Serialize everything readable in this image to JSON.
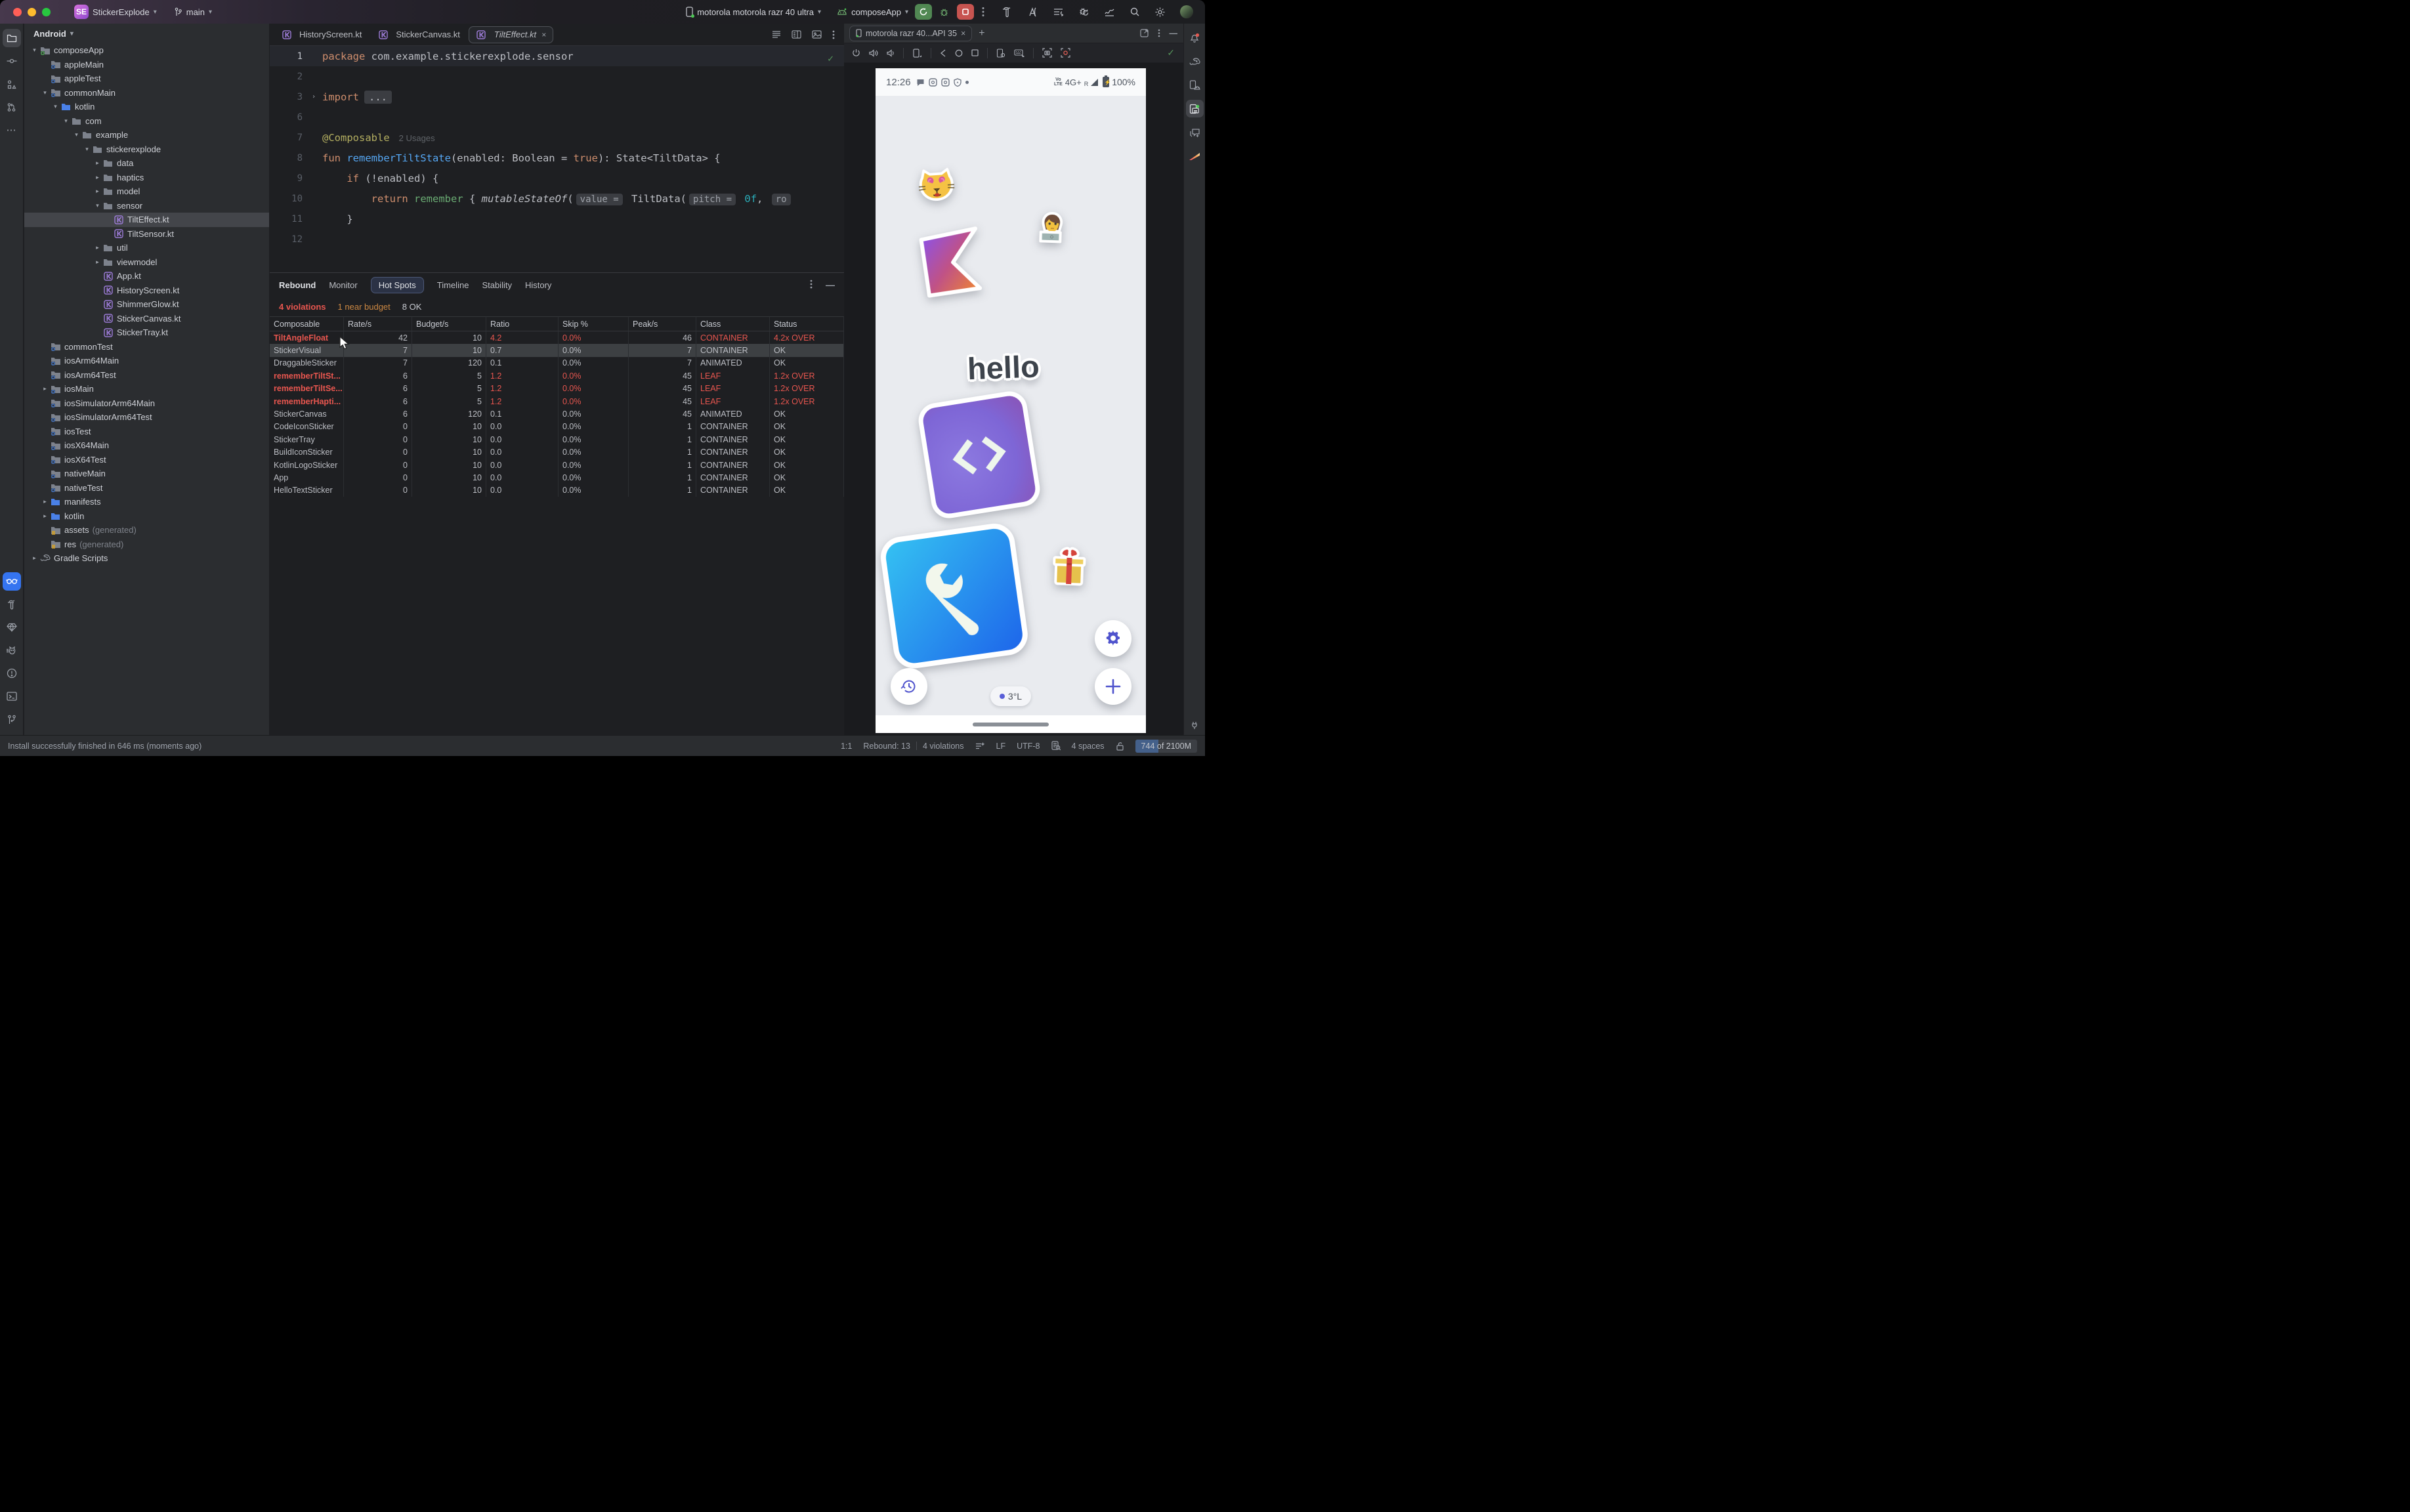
{
  "title_bar": {
    "project_abbr": "SE",
    "project_name": "StickerExplode",
    "branch": "main",
    "device_selector": "motorola motorola razr 40 ultra",
    "run_config": "composeApp"
  },
  "project_panel": {
    "header": "Android",
    "tree": [
      {
        "label": "composeApp",
        "depth": 0,
        "arrow": "v",
        "icon": "module-green"
      },
      {
        "label": "appleMain",
        "depth": 1,
        "arrow": "",
        "icon": "module-blue"
      },
      {
        "label": "appleTest",
        "depth": 1,
        "arrow": "",
        "icon": "module-blue"
      },
      {
        "label": "commonMain",
        "depth": 1,
        "arrow": "v",
        "icon": "module-blue"
      },
      {
        "label": "kotlin",
        "depth": 2,
        "arrow": "v",
        "icon": "folder-blue"
      },
      {
        "label": "com",
        "depth": 3,
        "arrow": "v",
        "icon": "folder"
      },
      {
        "label": "example",
        "depth": 4,
        "arrow": "v",
        "icon": "folder"
      },
      {
        "label": "stickerexplode",
        "depth": 5,
        "arrow": "v",
        "icon": "folder"
      },
      {
        "label": "data",
        "depth": 6,
        "arrow": ">",
        "icon": "folder"
      },
      {
        "label": "haptics",
        "depth": 6,
        "arrow": ">",
        "icon": "folder"
      },
      {
        "label": "model",
        "depth": 6,
        "arrow": ">",
        "icon": "folder"
      },
      {
        "label": "sensor",
        "depth": 6,
        "arrow": "v",
        "icon": "folder"
      },
      {
        "label": "TiltEffect.kt",
        "depth": 7,
        "arrow": "",
        "icon": "kt",
        "selected": true
      },
      {
        "label": "TiltSensor.kt",
        "depth": 7,
        "arrow": "",
        "icon": "kt"
      },
      {
        "label": "util",
        "depth": 6,
        "arrow": ">",
        "icon": "folder"
      },
      {
        "label": "viewmodel",
        "depth": 6,
        "arrow": ">",
        "icon": "folder"
      },
      {
        "label": "App.kt",
        "depth": 6,
        "arrow": "",
        "icon": "kt"
      },
      {
        "label": "HistoryScreen.kt",
        "depth": 6,
        "arrow": "",
        "icon": "kt"
      },
      {
        "label": "ShimmerGlow.kt",
        "depth": 6,
        "arrow": "",
        "icon": "kt"
      },
      {
        "label": "StickerCanvas.kt",
        "depth": 6,
        "arrow": "",
        "icon": "kt"
      },
      {
        "label": "StickerTray.kt",
        "depth": 6,
        "arrow": "",
        "icon": "kt"
      },
      {
        "label": "commonTest",
        "depth": 1,
        "arrow": "",
        "icon": "module-blue"
      },
      {
        "label": "iosArm64Main",
        "depth": 1,
        "arrow": "",
        "icon": "module-blue"
      },
      {
        "label": "iosArm64Test",
        "depth": 1,
        "arrow": "",
        "icon": "module-blue"
      },
      {
        "label": "iosMain",
        "depth": 1,
        "arrow": ">",
        "icon": "module-blue"
      },
      {
        "label": "iosSimulatorArm64Main",
        "depth": 1,
        "arrow": "",
        "icon": "module-blue"
      },
      {
        "label": "iosSimulatorArm64Test",
        "depth": 1,
        "arrow": "",
        "icon": "module-blue"
      },
      {
        "label": "iosTest",
        "depth": 1,
        "arrow": "",
        "icon": "module-blue"
      },
      {
        "label": "iosX64Main",
        "depth": 1,
        "arrow": "",
        "icon": "module-blue"
      },
      {
        "label": "iosX64Test",
        "depth": 1,
        "arrow": "",
        "icon": "module-blue"
      },
      {
        "label": "nativeMain",
        "depth": 1,
        "arrow": "",
        "icon": "module-blue"
      },
      {
        "label": "nativeTest",
        "depth": 1,
        "arrow": "",
        "icon": "module-blue"
      },
      {
        "label": "manifests",
        "depth": 1,
        "arrow": ">",
        "icon": "folder-blue"
      },
      {
        "label": "kotlin",
        "depth": 1,
        "arrow": ">",
        "icon": "folder-blue"
      },
      {
        "label": "assets",
        "depth": 1,
        "arrow": "",
        "icon": "folder-gen",
        "suffix": "(generated)"
      },
      {
        "label": "res",
        "depth": 1,
        "arrow": "",
        "icon": "folder-gen",
        "suffix": "(generated)"
      },
      {
        "label": "Gradle Scripts",
        "depth": 0,
        "arrow": ">",
        "icon": "gradle"
      }
    ]
  },
  "editor": {
    "tabs": [
      {
        "label": "HistoryScreen.kt",
        "active": false
      },
      {
        "label": "StickerCanvas.kt",
        "active": false
      },
      {
        "label": "TiltEffect.kt",
        "active": true,
        "close": "×"
      }
    ],
    "code_lines": [
      {
        "n": "1",
        "current": true,
        "tokens": [
          [
            "kw",
            "package"
          ],
          [
            "pl",
            " com.example.stickerexplode.sensor"
          ]
        ]
      },
      {
        "n": "2",
        "tokens": []
      },
      {
        "n": "3",
        "fold": true,
        "tokens": [
          [
            "kw",
            "import"
          ],
          [
            "fold",
            "..."
          ]
        ]
      },
      {
        "n": "6",
        "tokens": []
      },
      {
        "n": "7",
        "tokens": [
          [
            "ann",
            "@Composable"
          ],
          [
            "hint",
            "2 Usages"
          ]
        ]
      },
      {
        "n": "8",
        "tokens": [
          [
            "kw",
            "fun "
          ],
          [
            "fn",
            "rememberTiltState"
          ],
          [
            "pl",
            "(enabled: Boolean = "
          ],
          [
            "kw",
            "true"
          ],
          [
            "pl",
            "): State<TiltData> {"
          ]
        ]
      },
      {
        "n": "9",
        "tokens": [
          [
            "pl",
            "    "
          ],
          [
            "kw",
            "if"
          ],
          [
            "pl",
            " (!enabled) {"
          ]
        ]
      },
      {
        "n": "10",
        "tokens": [
          [
            "pl",
            "        "
          ],
          [
            "kw",
            "return"
          ],
          [
            "pl",
            " "
          ],
          [
            "grn",
            "remember"
          ],
          [
            "pl",
            " { "
          ],
          [
            "it",
            "mutableStateOf"
          ],
          [
            "pl",
            "("
          ],
          [
            "chip",
            "value ="
          ],
          [
            "pl",
            " TiltData("
          ],
          [
            "chip",
            "pitch ="
          ],
          [
            "pl",
            " "
          ],
          [
            "num",
            "0f"
          ],
          [
            "pl",
            ", "
          ],
          [
            "chip",
            "ro"
          ]
        ]
      },
      {
        "n": "11",
        "tokens": [
          [
            "pl",
            "    }"
          ]
        ]
      },
      {
        "n": "12",
        "tokens": []
      }
    ]
  },
  "rebound": {
    "title": "Rebound",
    "tabs": [
      "Monitor",
      "Hot Spots",
      "Timeline",
      "Stability",
      "History"
    ],
    "active_tab": "Hot Spots",
    "summary": {
      "violations": "4 violations",
      "near_budget": "1 near budget",
      "ok": "8 OK"
    },
    "columns": [
      "Composable",
      "Rate/s",
      "Budget/s",
      "Ratio",
      "Skip %",
      "Peak/s",
      "Class",
      "Status"
    ],
    "rows": [
      {
        "name": "TiltAngleFloat",
        "rate": "42",
        "budget": "10",
        "ratio": "4.2",
        "skip": "0.0%",
        "peak": "46",
        "cls": "CONTAINER",
        "status": "4.2x OVER",
        "level": "over"
      },
      {
        "name": "StickerVisual",
        "rate": "7",
        "budget": "10",
        "ratio": "0.7",
        "skip": "0.0%",
        "peak": "7",
        "cls": "CONTAINER",
        "status": "OK",
        "level": "ok",
        "selected": true
      },
      {
        "name": "DraggableSticker",
        "rate": "7",
        "budget": "120",
        "ratio": "0.1",
        "skip": "0.0%",
        "peak": "7",
        "cls": "ANIMATED",
        "status": "OK",
        "level": "ok"
      },
      {
        "name": "rememberTiltSt...",
        "rate": "6",
        "budget": "5",
        "ratio": "1.2",
        "skip": "0.0%",
        "peak": "45",
        "cls": "LEAF",
        "status": "1.2x OVER",
        "level": "over"
      },
      {
        "name": "rememberTiltSe...",
        "rate": "6",
        "budget": "5",
        "ratio": "1.2",
        "skip": "0.0%",
        "peak": "45",
        "cls": "LEAF",
        "status": "1.2x OVER",
        "level": "over"
      },
      {
        "name": "rememberHapti...",
        "rate": "6",
        "budget": "5",
        "ratio": "1.2",
        "skip": "0.0%",
        "peak": "45",
        "cls": "LEAF",
        "status": "1.2x OVER",
        "level": "over"
      },
      {
        "name": "StickerCanvas",
        "rate": "6",
        "budget": "120",
        "ratio": "0.1",
        "skip": "0.0%",
        "peak": "45",
        "cls": "ANIMATED",
        "status": "OK",
        "level": "ok"
      },
      {
        "name": "CodeIconSticker",
        "rate": "0",
        "budget": "10",
        "ratio": "0.0",
        "skip": "0.0%",
        "peak": "1",
        "cls": "CONTAINER",
        "status": "OK",
        "level": "ok"
      },
      {
        "name": "StickerTray",
        "rate": "0",
        "budget": "10",
        "ratio": "0.0",
        "skip": "0.0%",
        "peak": "1",
        "cls": "CONTAINER",
        "status": "OK",
        "level": "ok"
      },
      {
        "name": "BuildIconSticker",
        "rate": "0",
        "budget": "10",
        "ratio": "0.0",
        "skip": "0.0%",
        "peak": "1",
        "cls": "CONTAINER",
        "status": "OK",
        "level": "ok"
      },
      {
        "name": "KotlinLogoSticker",
        "rate": "0",
        "budget": "10",
        "ratio": "0.0",
        "skip": "0.0%",
        "peak": "1",
        "cls": "CONTAINER",
        "status": "OK",
        "level": "ok"
      },
      {
        "name": "App",
        "rate": "0",
        "budget": "10",
        "ratio": "0.0",
        "skip": "0.0%",
        "peak": "1",
        "cls": "CONTAINER",
        "status": "OK",
        "level": "ok"
      },
      {
        "name": "HelloTextSticker",
        "rate": "0",
        "budget": "10",
        "ratio": "0.0",
        "skip": "0.0%",
        "peak": "1",
        "cls": "CONTAINER",
        "status": "OK",
        "level": "ok"
      }
    ]
  },
  "devices": {
    "tab_label": "motorola razr 40...API 35",
    "tab_close": "×",
    "screen": {
      "time": "12:26",
      "network": "4G+",
      "roaming": "R",
      "volte_top": "Vo",
      "volte_bottom": "LTE",
      "battery": "100%",
      "hello": "hello",
      "temp_chip": "3°L"
    }
  },
  "status_bar": {
    "left_message": "Install successfully finished in 646 ms (moments ago)",
    "caret": "1:1",
    "rebound_count": "Rebound: 13",
    "violations": "4 violations",
    "line_ending": "LF",
    "encoding": "UTF-8",
    "indent": "4 spaces",
    "memory": "744 of 2100M"
  },
  "colors": {
    "accent_red": "#e8564f",
    "accent_orange": "#cb8742",
    "run_green": "#518853",
    "stop_red": "#c75450",
    "selection": "#43454a"
  }
}
